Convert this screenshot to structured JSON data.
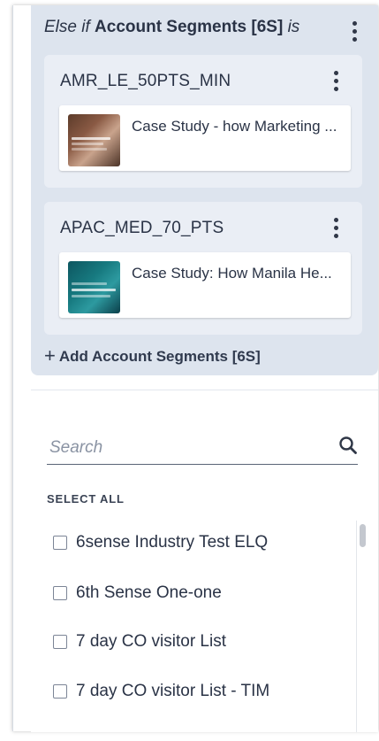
{
  "rule": {
    "keyword": "Else if",
    "field": "Account Segments [6S]",
    "operator": "is",
    "menu_icon": "kebab-menu-icon"
  },
  "segments": [
    {
      "name": "AMR_LE_50PTS_MIN",
      "menu_icon": "kebab-menu-icon",
      "content": {
        "title": "Case Study - how Marketing ...",
        "thumbnail": "case-study-thumbnail"
      }
    },
    {
      "name": "APAC_MED_70_PTS",
      "menu_icon": "kebab-menu-icon",
      "content": {
        "title": "Case Study: How Manila He...",
        "thumbnail": "case-study-thumbnail"
      }
    }
  ],
  "add_segment": {
    "icon": "plus-icon",
    "label": "Add Account Segments [6S]"
  },
  "dropdown": {
    "search_placeholder": "Search",
    "search_icon": "search-icon",
    "select_all_label": "SELECT ALL",
    "options": [
      {
        "label": "6sense Industry Test ELQ",
        "checked": false
      },
      {
        "label": "6th Sense One-one",
        "checked": false
      },
      {
        "label": "7 day CO visitor List",
        "checked": false
      },
      {
        "label": "7 day CO visitor List - TIM",
        "checked": false
      }
    ]
  },
  "colors": {
    "panel_bg": "#dde4ee",
    "card_bg": "#eaeef5",
    "text": "#2a3346"
  }
}
